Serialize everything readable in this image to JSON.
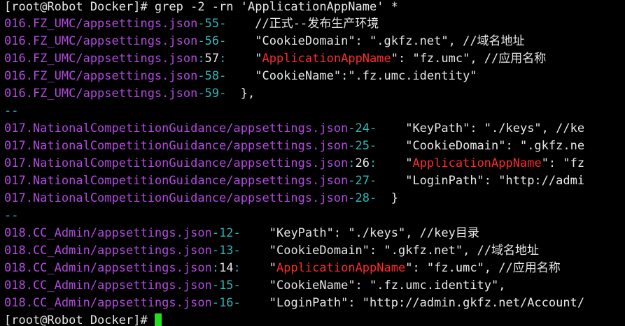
{
  "colors": {
    "default": "#e6e6e6",
    "filename": "#b24ae0",
    "separator": "#2fb7b7",
    "match": "#ff2a2a",
    "cursor": "#22dd22"
  },
  "lines": [
    [
      {
        "t": "[root@Robot Docker]# grep -2 -rn 'ApplicationAppName' *",
        "c": "default"
      }
    ],
    [
      {
        "t": "016.FZ_UMC/appsettings.json",
        "c": "filename"
      },
      {
        "t": "-",
        "c": "separator"
      },
      {
        "t": "55",
        "c": "separator"
      },
      {
        "t": "-",
        "c": "separator"
      },
      {
        "t": "    //正式--发布生产环境",
        "c": "default"
      }
    ],
    [
      {
        "t": "016.FZ_UMC/appsettings.json",
        "c": "filename"
      },
      {
        "t": "-",
        "c": "separator"
      },
      {
        "t": "56",
        "c": "separator"
      },
      {
        "t": "-",
        "c": "separator"
      },
      {
        "t": "    \"CookieDomain\": \".gkfz.net\", //域名地址",
        "c": "default"
      }
    ],
    [
      {
        "t": "016.FZ_UMC/appsettings.json",
        "c": "filename"
      },
      {
        "t": ":",
        "c": "separator"
      },
      {
        "t": "57",
        "c": "default"
      },
      {
        "t": ":",
        "c": "separator"
      },
      {
        "t": "    \"",
        "c": "default"
      },
      {
        "t": "ApplicationAppName",
        "c": "match"
      },
      {
        "t": "\": \"fz.umc\", //应用名称",
        "c": "default"
      }
    ],
    [
      {
        "t": "016.FZ_UMC/appsettings.json",
        "c": "filename"
      },
      {
        "t": "-",
        "c": "separator"
      },
      {
        "t": "58",
        "c": "separator"
      },
      {
        "t": "-",
        "c": "separator"
      },
      {
        "t": "    \"CookieName\":\".fz.umc.identity\"",
        "c": "default"
      }
    ],
    [
      {
        "t": "016.FZ_UMC/appsettings.json",
        "c": "filename"
      },
      {
        "t": "-",
        "c": "separator"
      },
      {
        "t": "59",
        "c": "separator"
      },
      {
        "t": "-",
        "c": "separator"
      },
      {
        "t": "  },",
        "c": "default"
      }
    ],
    [
      {
        "t": "--",
        "c": "separator"
      }
    ],
    [
      {
        "t": "017.NationalCompetitionGuidance/appsettings.json",
        "c": "filename"
      },
      {
        "t": "-",
        "c": "separator"
      },
      {
        "t": "24",
        "c": "separator"
      },
      {
        "t": "-",
        "c": "separator"
      },
      {
        "t": "    \"KeyPath\": \"./keys\", //ke",
        "c": "default"
      }
    ],
    [
      {
        "t": "017.NationalCompetitionGuidance/appsettings.json",
        "c": "filename"
      },
      {
        "t": "-",
        "c": "separator"
      },
      {
        "t": "25",
        "c": "separator"
      },
      {
        "t": "-",
        "c": "separator"
      },
      {
        "t": "    \"CookieDomain\": \".gkfz.ne",
        "c": "default"
      }
    ],
    [
      {
        "t": "017.NationalCompetitionGuidance/appsettings.json",
        "c": "filename"
      },
      {
        "t": ":",
        "c": "separator"
      },
      {
        "t": "26",
        "c": "default"
      },
      {
        "t": ":",
        "c": "separator"
      },
      {
        "t": "    \"",
        "c": "default"
      },
      {
        "t": "ApplicationAppName",
        "c": "match"
      },
      {
        "t": "\": \"fz",
        "c": "default"
      }
    ],
    [
      {
        "t": "017.NationalCompetitionGuidance/appsettings.json",
        "c": "filename"
      },
      {
        "t": "-",
        "c": "separator"
      },
      {
        "t": "27",
        "c": "separator"
      },
      {
        "t": "-",
        "c": "separator"
      },
      {
        "t": "    \"LoginPath\": \"http://admi",
        "c": "default"
      }
    ],
    [
      {
        "t": "017.NationalCompetitionGuidance/appsettings.json",
        "c": "filename"
      },
      {
        "t": "-",
        "c": "separator"
      },
      {
        "t": "28",
        "c": "separator"
      },
      {
        "t": "-",
        "c": "separator"
      },
      {
        "t": "  }",
        "c": "default"
      }
    ],
    [
      {
        "t": "--",
        "c": "separator"
      }
    ],
    [
      {
        "t": "018.CC_Admin/appsettings.json",
        "c": "filename"
      },
      {
        "t": "-",
        "c": "separator"
      },
      {
        "t": "12",
        "c": "separator"
      },
      {
        "t": "-",
        "c": "separator"
      },
      {
        "t": "    \"KeyPath\": \"./keys\", //key目录",
        "c": "default"
      }
    ],
    [
      {
        "t": "018.CC_Admin/appsettings.json",
        "c": "filename"
      },
      {
        "t": "-",
        "c": "separator"
      },
      {
        "t": "13",
        "c": "separator"
      },
      {
        "t": "-",
        "c": "separator"
      },
      {
        "t": "    \"CookieDomain\": \".gkfz.net\", //域名地址",
        "c": "default"
      }
    ],
    [
      {
        "t": "018.CC_Admin/appsettings.json",
        "c": "filename"
      },
      {
        "t": ":",
        "c": "separator"
      },
      {
        "t": "14",
        "c": "default"
      },
      {
        "t": ":",
        "c": "separator"
      },
      {
        "t": "    \"",
        "c": "default"
      },
      {
        "t": "ApplicationAppName",
        "c": "match"
      },
      {
        "t": "\": \"fz.umc\", //应用名称",
        "c": "default"
      }
    ],
    [
      {
        "t": "018.CC_Admin/appsettings.json",
        "c": "filename"
      },
      {
        "t": "-",
        "c": "separator"
      },
      {
        "t": "15",
        "c": "separator"
      },
      {
        "t": "-",
        "c": "separator"
      },
      {
        "t": "    \"CookieName\": \".fz.umc.identity\",",
        "c": "default"
      }
    ],
    [
      {
        "t": "018.CC_Admin/appsettings.json",
        "c": "filename"
      },
      {
        "t": "-",
        "c": "separator"
      },
      {
        "t": "16",
        "c": "separator"
      },
      {
        "t": "-",
        "c": "separator"
      },
      {
        "t": "    \"LoginPath\": \"http://admin.gkfz.net/Account/",
        "c": "default"
      }
    ],
    [
      {
        "t": "[root@Robot Docker]# ",
        "c": "default"
      }
    ]
  ]
}
